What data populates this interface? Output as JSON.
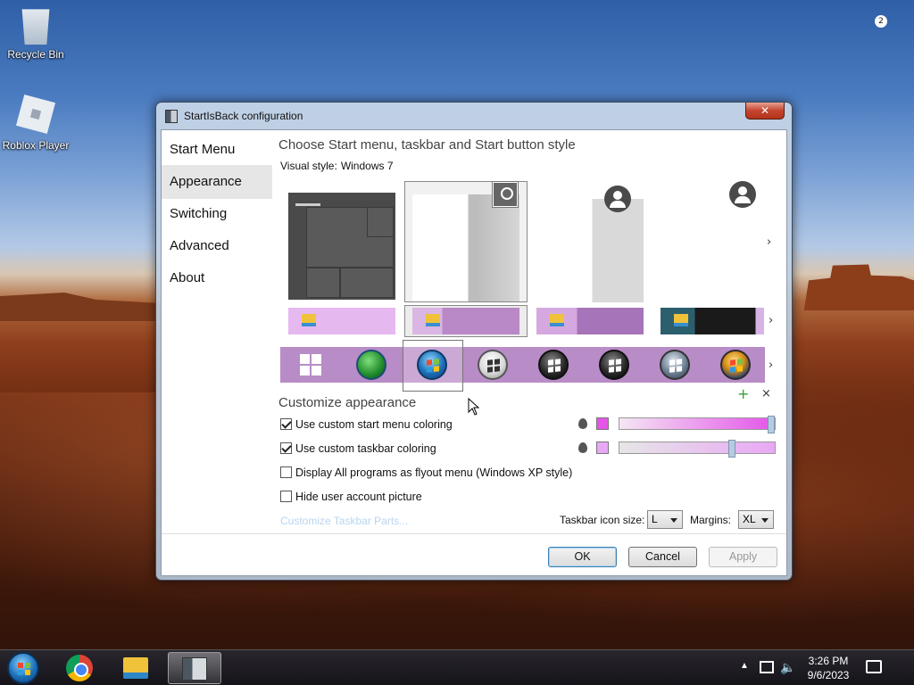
{
  "desktop": {
    "icons": [
      {
        "label": "Recycle Bin",
        "icon": "recycle-bin-icon"
      },
      {
        "label": "Roblox Player",
        "icon": "roblox-icon"
      }
    ]
  },
  "window": {
    "title": "StartIsBack configuration",
    "close_glyph": "✕",
    "nav": [
      "Start Menu",
      "Appearance",
      "Switching",
      "Advanced",
      "About"
    ],
    "active_nav": "Appearance",
    "heading": "Choose Start menu, taskbar and Start button style",
    "visual_style_label": "Visual style:",
    "visual_style_value": "Windows 7",
    "more_glyph": "›",
    "customize_heading": "Customize appearance",
    "options": [
      {
        "label": "Use custom start menu coloring",
        "checked": true,
        "color": "#e455e8",
        "slider": 1.0
      },
      {
        "label": "Use custom taskbar coloring",
        "checked": true,
        "color": "#e9a8f5",
        "slider": 0.72
      },
      {
        "label": "Display All programs as flyout menu (Windows XP style)",
        "checked": false
      },
      {
        "label": "Hide user account picture",
        "checked": false
      }
    ],
    "customize_link": "Customize Taskbar Parts...",
    "taskbar_icon_size_label": "Taskbar icon size:",
    "taskbar_icon_size_value": "L",
    "margins_label": "Margins:",
    "margins_value": "XL",
    "add_glyph": "+",
    "remove_glyph": "×",
    "buttons": {
      "ok": "OK",
      "cancel": "Cancel",
      "apply": "Apply"
    }
  },
  "taskbar": {
    "time": "3:26 PM",
    "date": "9/6/2023",
    "notification_count": "2",
    "tray_arrow": "▲",
    "volume_glyph": "🔈"
  }
}
